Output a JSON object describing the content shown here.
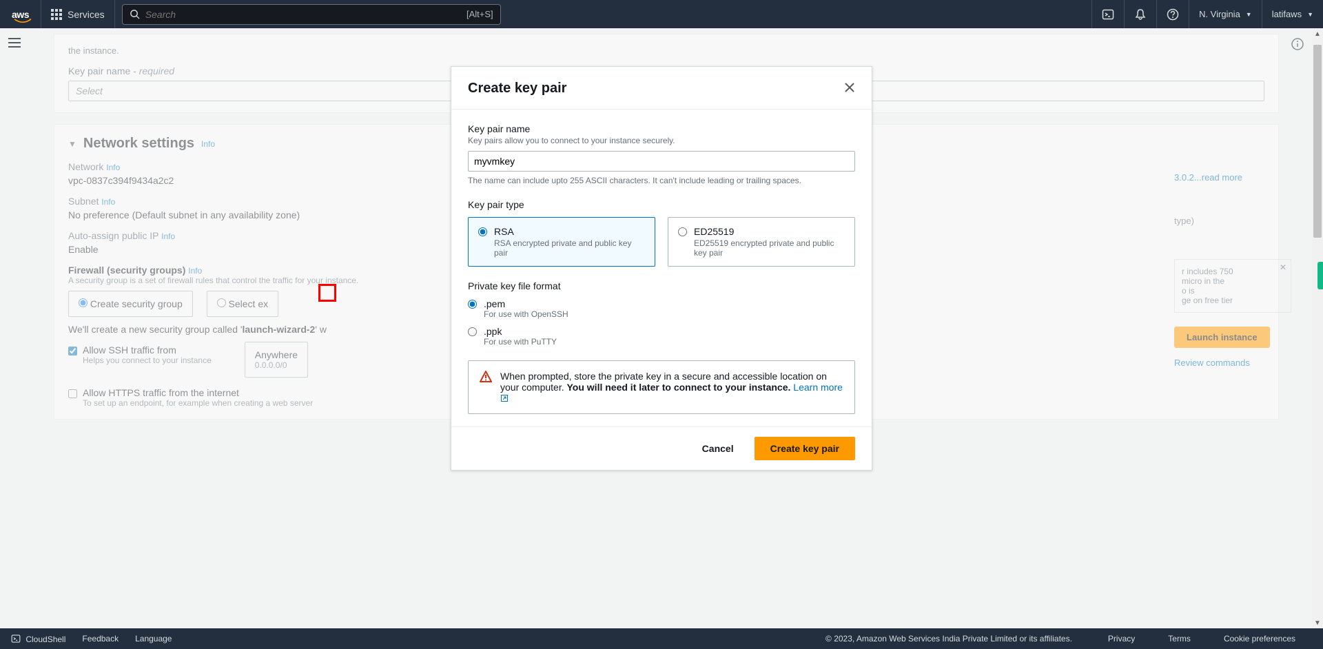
{
  "nav": {
    "services": "Services",
    "search_placeholder": "Search",
    "shortcut": "[Alt+S]",
    "region": "N. Virginia",
    "account": "latifaws"
  },
  "bg": {
    "keypair_intro": "the instance.",
    "keypair_label": "Key pair name - ",
    "keypair_required": "required",
    "select_ph": "Select",
    "netset_title": "Network settings",
    "info": "Info",
    "network_label": "Network",
    "network_val": "vpc-0837c394f9434a2c2",
    "subnet_label": "Subnet",
    "subnet_val": "No preference (Default subnet in any availability zone)",
    "autoip_label": "Auto-assign public IP",
    "autoip_val": "Enable",
    "fw_label": "Firewall (security groups)",
    "fw_desc": "A security group is a set of firewall rules that control the traffic for your instance.",
    "sg_create": "Create security group",
    "sg_select": "Select ex",
    "sg_msg_pre": "We'll create a new security group called '",
    "sg_msg_name": "launch-wizard-2",
    "sg_msg_post": "' w",
    "allow_ssh": "Allow SSH traffic from",
    "allow_ssh_desc": "Helps you connect to your instance",
    "anywhere": "Anywhere",
    "anywhere_cidr": "0.0.0.0/0",
    "allow_https": "Allow HTTPS traffic from the internet",
    "allow_https_desc": "To set up an endpoint, for example when creating a web server"
  },
  "right": {
    "readmore": "3.0.2...read more",
    "type_hint": "type)",
    "free1": "r includes 750",
    "free2": "micro in the",
    "free3": "o is",
    "free4": "ge on free tier",
    "launch": "Launch instance",
    "review": "Review commands"
  },
  "modal": {
    "title": "Create key pair",
    "name_label": "Key pair name",
    "name_desc": "Key pairs allow you to connect to your instance securely.",
    "name_value": "myvmkey",
    "name_help": "The name can include upto 255 ASCII characters. It can't include leading or trailing spaces.",
    "type_label": "Key pair type",
    "rsa_title": "RSA",
    "rsa_desc": "RSA encrypted private and public key pair",
    "ed_title": "ED25519",
    "ed_desc": "ED25519 encrypted private and public key pair",
    "format_label": "Private key file format",
    "pem_title": ".pem",
    "pem_desc": "For use with OpenSSH",
    "ppk_title": ".ppk",
    "ppk_desc": "For use with PuTTY",
    "alert_text": "When prompted, store the private key in a secure and accessible location on your computer. ",
    "alert_bold": "You will need it later to connect to your instance.",
    "alert_link": "Learn more",
    "cancel": "Cancel",
    "create": "Create key pair"
  },
  "footer": {
    "cloudshell": "CloudShell",
    "feedback": "Feedback",
    "language": "Language",
    "copyright": "© 2023, Amazon Web Services India Private Limited or its affiliates.",
    "privacy": "Privacy",
    "terms": "Terms",
    "cookie": "Cookie preferences"
  }
}
